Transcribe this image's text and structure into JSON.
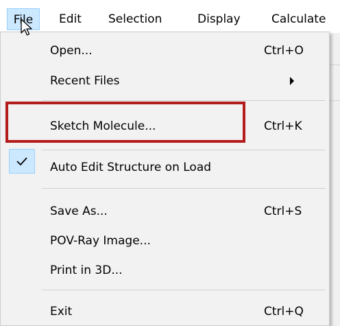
{
  "menubar": {
    "items": [
      {
        "label": "File"
      },
      {
        "label": "Edit"
      },
      {
        "label": "Selection"
      },
      {
        "label": "Display"
      },
      {
        "label": "Calculate"
      }
    ]
  },
  "file_menu": {
    "open": {
      "label": "Open...",
      "shortcut": "Ctrl+O"
    },
    "recent_files": {
      "label": "Recent Files"
    },
    "sketch_molecule": {
      "label": "Sketch Molecule...",
      "shortcut": "Ctrl+K"
    },
    "auto_edit": {
      "label": "Auto Edit Structure on Load",
      "checked": true
    },
    "save_as": {
      "label": "Save As...",
      "shortcut": "Ctrl+S"
    },
    "povray": {
      "label": "POV-Ray Image..."
    },
    "print3d": {
      "label": "Print in 3D..."
    },
    "exit": {
      "label": "Exit",
      "shortcut": "Ctrl+Q"
    }
  },
  "colors": {
    "highlight_border": "#b41c1c",
    "selection_fill": "#cce8ff",
    "checkmark": "#000000"
  },
  "icons": {
    "check": "checkmark-icon",
    "submenu": "chevron-right-icon",
    "cursor": "mouse-pointer-icon"
  }
}
